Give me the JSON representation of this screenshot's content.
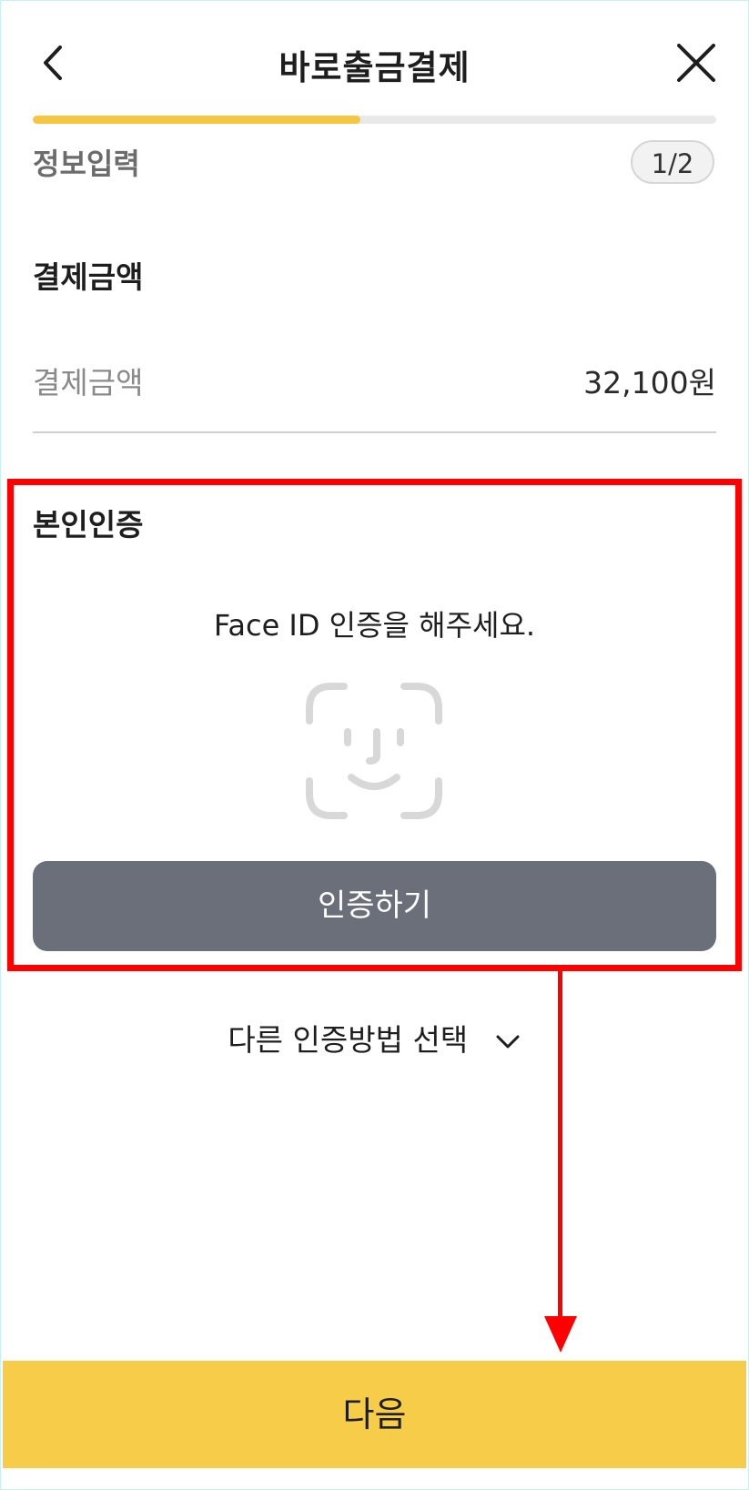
{
  "header": {
    "title": "바로출금결제",
    "back_icon": "chevron-left-icon",
    "close_icon": "close-icon"
  },
  "progress": {
    "fraction": 0.48,
    "step_label": "정보입력",
    "step_badge": "1/2",
    "color": "#f6c643"
  },
  "payment": {
    "section_title": "결제금액",
    "amount_label": "결제금액",
    "amount_value": "32,100원"
  },
  "verification": {
    "section_title": "본인인증",
    "prompt": "Face ID 인증을 해주세요.",
    "icon": "face-id-icon",
    "button_label": "인증하기"
  },
  "other_method": {
    "label": "다른 인증방법 선택",
    "icon": "chevron-down-icon"
  },
  "footer": {
    "next_label": "다음",
    "color": "#f6cc48"
  },
  "annotation_color": "#ff0000"
}
